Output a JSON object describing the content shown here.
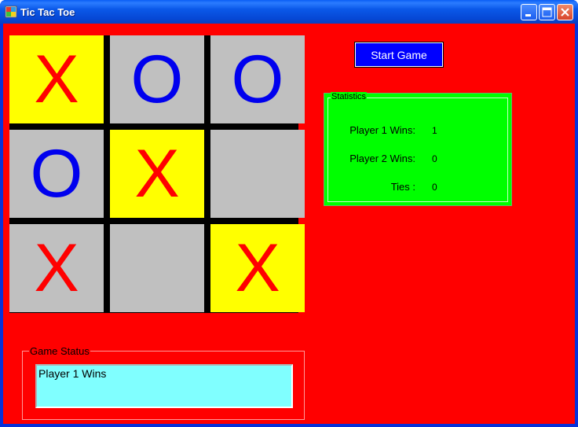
{
  "window": {
    "title": "Tic Tac Toe",
    "icon": "tic-tac-toe-app-icon"
  },
  "title_buttons": [
    "minimize",
    "maximize",
    "close"
  ],
  "colors": {
    "client_bg": "#ff0000",
    "highlight_cell": "#ffff00",
    "normal_cell": "#c0c0c0",
    "x_mark": "#ff0000",
    "o_mark": "#0000ee",
    "stats_bg": "#00ff00",
    "status_bg": "#80ffff",
    "start_button_bg": "#0000ff"
  },
  "board": {
    "cells": [
      {
        "mark": "X",
        "highlight": true
      },
      {
        "mark": "O",
        "highlight": false
      },
      {
        "mark": "O",
        "highlight": false
      },
      {
        "mark": "O",
        "highlight": false
      },
      {
        "mark": "X",
        "highlight": true
      },
      {
        "mark": "",
        "highlight": false
      },
      {
        "mark": "X",
        "highlight": false
      },
      {
        "mark": "",
        "highlight": false
      },
      {
        "mark": "X",
        "highlight": true
      }
    ]
  },
  "start_button": {
    "label": "Start Game"
  },
  "statistics": {
    "legend": "Statistics",
    "player1_label": "Player 1 Wins:",
    "player1_value": "1",
    "player2_label": "Player 2 Wins:",
    "player2_value": "0",
    "ties_label": "Ties :",
    "ties_value": "0"
  },
  "game_status": {
    "legend": "Game Status",
    "text": "Player 1 Wins"
  }
}
